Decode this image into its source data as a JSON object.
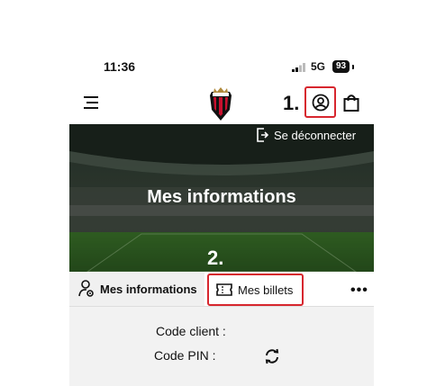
{
  "status_bar": {
    "time": "11:36",
    "network": "5G",
    "battery": "93"
  },
  "header": {
    "step1": "1."
  },
  "hero": {
    "logout_label": "Se déconnecter",
    "title": "Mes informations",
    "step2": "2."
  },
  "tabs": {
    "items": [
      {
        "label": "Mes informations"
      },
      {
        "label": "Mes billets"
      }
    ],
    "more": "•••"
  },
  "content": {
    "code_client_label": "Code client :",
    "code_pin_label": "Code PIN :"
  },
  "colors": {
    "highlight": "#d7262e",
    "brand_red": "#c8102e"
  },
  "icons": [
    "hamburger-menu-icon",
    "club-logo",
    "user-circle-icon",
    "shopping-bag-icon",
    "logout-icon",
    "user-settings-icon",
    "ticket-icon",
    "refresh-icon"
  ]
}
